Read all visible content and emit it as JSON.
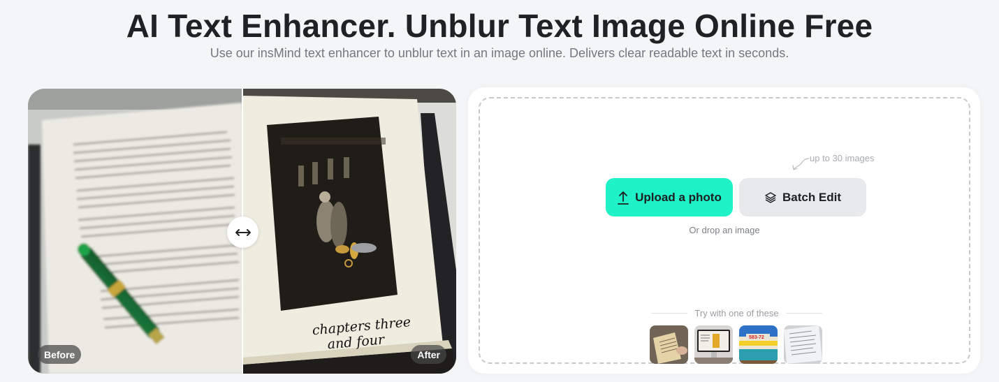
{
  "header": {
    "title": "AI Text Enhancer. Unblur Text Image Online Free",
    "subtitle": "Use our insMind text enhancer to unblur text in an image online. Delivers clear readable text in seconds."
  },
  "compare": {
    "before_label": "Before",
    "after_label": "After",
    "after_caption_line1": "chapters three",
    "after_caption_line2": "and four",
    "handle_icon": "left-right-arrow-icon"
  },
  "upload": {
    "upload_button_label": "Upload a photo",
    "upload_icon": "upload-arrow-icon",
    "batch_button_label": "Batch Edit",
    "batch_icon": "layers-icon",
    "batch_hint": "up to 30 images",
    "drop_text": "Or drop an image",
    "try_label": "Try with one of these",
    "samples": [
      {
        "name": "handwritten-letter"
      },
      {
        "name": "monitor-screen"
      },
      {
        "name": "storefront-sign"
      },
      {
        "name": "printed-document"
      }
    ]
  },
  "colors": {
    "accent": "#1ef2c6",
    "secondary_button": "#e8e9ec",
    "page_bg": "#f4f5f7"
  }
}
